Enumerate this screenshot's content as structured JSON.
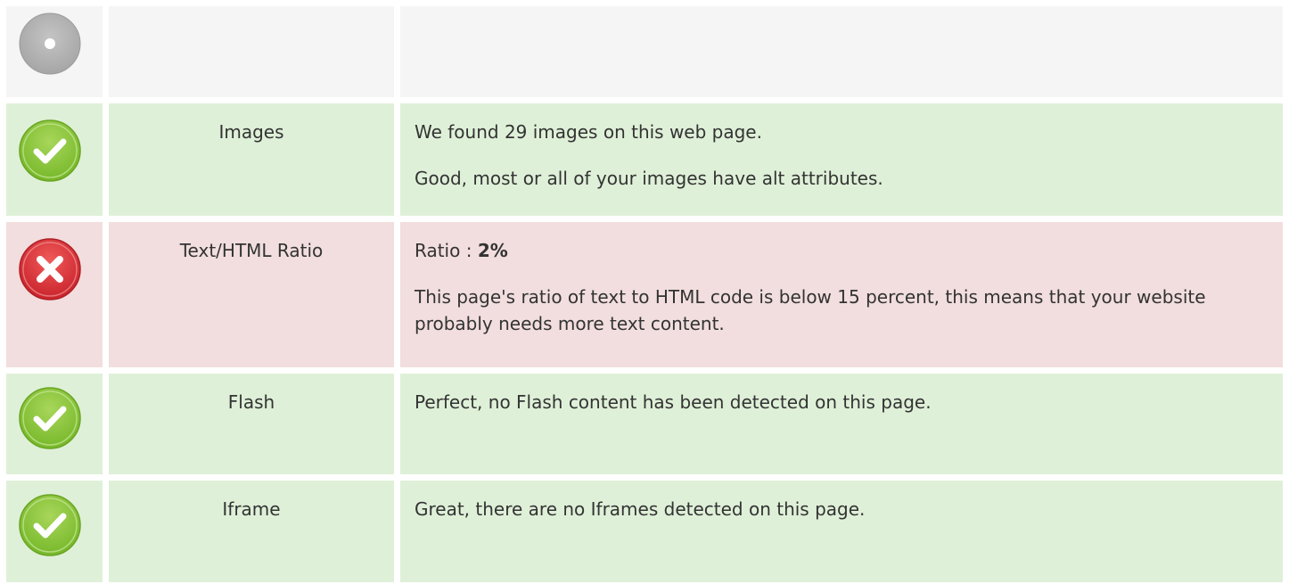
{
  "rows": [
    {
      "status": "neutral",
      "icon": "gray-circle-icon",
      "label": "",
      "lines": []
    },
    {
      "status": "pass",
      "icon": "green-check-icon",
      "label": "Images",
      "line1": "We found 29 images on this web page.",
      "line2": "Good, most or all of your images have alt attributes."
    },
    {
      "status": "fail",
      "icon": "red-x-icon",
      "label": "Text/HTML Ratio",
      "line1_prefix": "Ratio : ",
      "line1_value": "2%",
      "line2": "This page's ratio of text to HTML code is below 15 percent, this means that your website probably needs more text content."
    },
    {
      "status": "pass",
      "icon": "green-check-icon",
      "label": "Flash",
      "line1": "Perfect, no Flash content has been detected on this page."
    },
    {
      "status": "pass",
      "icon": "green-check-icon",
      "label": "Iframe",
      "line1": "Great, there are no Iframes detected on this page."
    }
  ],
  "colors": {
    "neutral_bg": "#f5f5f5",
    "pass_bg": "#dff0d8",
    "fail_bg": "#f2dede",
    "check_green": "#8cc63f",
    "error_red": "#d9363e",
    "neutral_gray": "#b3b3b3"
  }
}
